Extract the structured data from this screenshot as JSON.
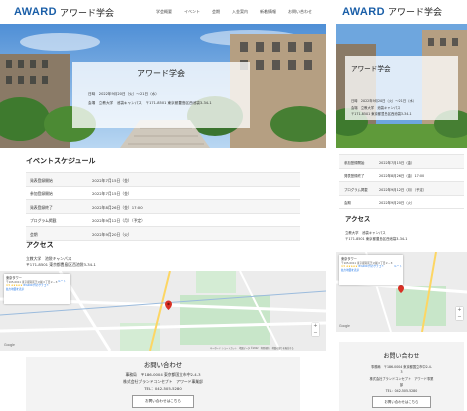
{
  "site": {
    "logo_en": "AWARD",
    "logo_jp": "アワード学会"
  },
  "nav": {
    "items": [
      "学会概要",
      "イベント",
      "会期",
      "入金案内",
      "新着情報",
      "お問い合わせ"
    ]
  },
  "hero": {
    "title": "アワード学会",
    "date_line": "日時　2022年9月20日（火）～21日（水）",
    "place_line": "会場　立教大学　池袋キャンパス　〒171-8501 東京都豊島区西池袋3-34-1",
    "m_date_line": "日時　2022年9月20日（火）～21日（水）",
    "m_place_line1": "会場　立教大学　池袋キャンパス",
    "m_place_line2": "〒171-8501 東京都豊島区西池袋3-34-1"
  },
  "schedule": {
    "title": "イベントスケジュール",
    "rows": [
      {
        "label": "発表登録開始",
        "value": "2022年7月15日（金）"
      },
      {
        "label": "参加登録開始",
        "value": "2022年7月15日（金）"
      },
      {
        "label": "発表登録終了",
        "value": "2022年8月26日（金）17:00"
      },
      {
        "label": "プログラム掲載",
        "value": "2022年9月12日（月）（予定）"
      },
      {
        "label": "会期",
        "value": "2022年9月20日（火）"
      }
    ],
    "mobile_rows": [
      {
        "label": "参加登録開始",
        "value": "2022年7月15日（金）"
      },
      {
        "label": "発表登録終了",
        "value": "2022年8月26日（金）17:00"
      },
      {
        "label": "プログラム掲載",
        "value": "2022年9月12日（月）（予定）"
      },
      {
        "label": "会期",
        "value": "2022年9月20日（火）"
      }
    ]
  },
  "access": {
    "title": "アクセス",
    "line1": "立教大学　池袋キャンパス",
    "line2": "〒171-8501 東京都豊島区西池袋3-34-1"
  },
  "map": {
    "card_title": "東京タワー",
    "card_addr": "〒105-0011 東京都港区芝公園４丁目２−８",
    "card_rating": "4.5",
    "card_stars": "★★★★★",
    "card_reviews": "83,600 件のクチコミ",
    "card_link": "拡大地図を表示",
    "directions": "ルート",
    "zoom_in": "+",
    "zoom_out": "−",
    "google": "Google",
    "footer": "キーボード ショートカット　地図データ ©2022　利用規約　地図の誤りを報告する"
  },
  "contact": {
    "title": "お問い合わせ",
    "office_line": "事務局　〒186-0004 東京都国立市中2-4-3",
    "company_line": "株式会社ブランドコンセプト　アワード事業部",
    "tel_line": "TEL：042-505-5280",
    "button": "お問い合わせはこちら",
    "m_office_line1": "事務局　〒186-0004 東京都国立市中2-4-",
    "m_office_line2": "3",
    "m_company_line1": "株式会社ブランドコンセプト　アワード事業",
    "m_company_line2": "部",
    "m_tel_line": "TEL：042-505-5280"
  },
  "colors": {
    "brand": "#1b5fa8",
    "table_stripe": "#f6f6f6",
    "contact_bg": "#f3f3f3",
    "map_pin": "#d93025"
  }
}
